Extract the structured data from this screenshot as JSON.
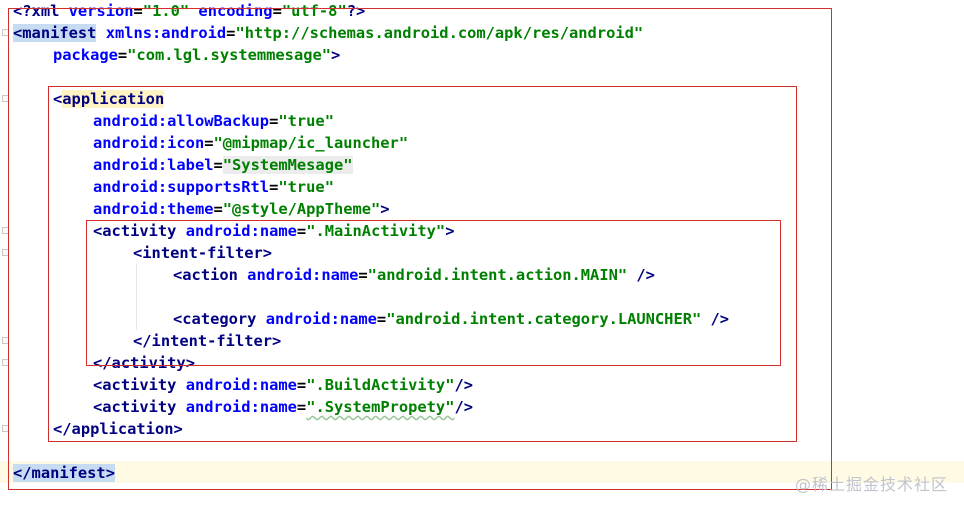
{
  "editor": {
    "lines": {
      "l1": {
        "lt": "<?",
        "tag": "xml",
        "a1": "version",
        "v1": "\"1.0\"",
        "a2": "encoding",
        "v2": "\"utf-8\"",
        "end": "?>"
      },
      "l2": {
        "lt": "<",
        "tag": "manifest",
        "a1": "xmlns:android",
        "v1": "\"http://schemas.android.com/apk/res/android\""
      },
      "l3": {
        "a1": "package",
        "v1": "\"com.lgl.systemmesage\"",
        "end": ">"
      },
      "l4": {
        "lt": "<",
        "tag": "application"
      },
      "l5": {
        "ns": "android",
        "a1": ":allowBackup",
        "v1": "\"true\""
      },
      "l6": {
        "ns": "android",
        "a1": ":icon",
        "v1": "\"@mipmap/ic_launcher\""
      },
      "l7": {
        "ns": "android",
        "a1": ":label",
        "v1": "\"SystemMesage\""
      },
      "l8": {
        "ns": "android",
        "a1": ":supportsRtl",
        "v1": "\"true\""
      },
      "l9": {
        "ns": "android",
        "a1": ":theme",
        "v1": "\"@style/AppTheme\"",
        "end": ">"
      },
      "l10": {
        "lt": "<",
        "tag": "activity",
        "ns": "android",
        "a1": ":name",
        "v1": "\".MainActivity\"",
        "end": ">"
      },
      "l11": {
        "lt": "<",
        "tag": "intent-filter",
        "end": ">"
      },
      "l12": {
        "lt": "<",
        "tag": "action",
        "ns": "android",
        "a1": ":name",
        "v1": "\"android.intent.action.MAIN\"",
        "end": " />"
      },
      "l13": {
        "lt": "<",
        "tag": "category",
        "ns": "android",
        "a1": ":name",
        "v1": "\"android.intent.category.LAUNCHER\"",
        "end": " />"
      },
      "l14": {
        "lt": "</",
        "tag": "intent-filter",
        "end": ">"
      },
      "l15": {
        "lt": "</",
        "tag": "activity",
        "end": ">"
      },
      "l16": {
        "lt": "<",
        "tag": "activity",
        "ns": "android",
        "a1": ":name",
        "v1": "\".BuildActivity\"",
        "end": "/>"
      },
      "l17": {
        "lt": "<",
        "tag": "activity",
        "ns": "android",
        "a1": ":name",
        "v1": "\".SystemPropety\"",
        "end": "/>"
      },
      "l18": {
        "lt": "</",
        "tag": "application",
        "end": ">"
      },
      "l19": {
        "lt": "</",
        "tag": "manifest",
        "end": ">"
      }
    }
  },
  "watermark": {
    "text": "@稀土掘金技术社区"
  },
  "colors": {
    "tag": "#000080",
    "attribute": "#0000ff",
    "value": "#008000",
    "annotation_box": "#d32f2f",
    "current_line": "#fffae3",
    "tag_highlight": "#c6dcf3"
  }
}
